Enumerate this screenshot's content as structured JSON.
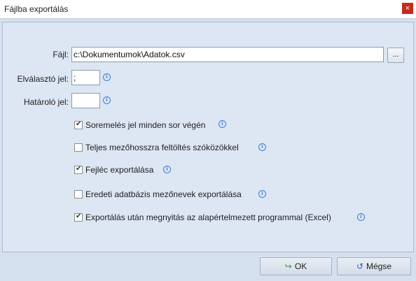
{
  "window": {
    "title": "Fájlba exportálás",
    "close_glyph": "×"
  },
  "form": {
    "file_label": "Fájl:",
    "file_value": "c:\\Dokumentumok\\Adatok.csv",
    "browse_label": "...",
    "separator_label": "Elválasztó jel:",
    "separator_value": ";",
    "delimiter_label": "Határoló jel:",
    "delimiter_value": ""
  },
  "options": [
    {
      "label": "Soremelés jel minden sor végén",
      "checked": true
    },
    {
      "label": "Teljes mezőhosszra feltöltés szóközökkel",
      "checked": false
    },
    {
      "label": "Fejléc exportálása",
      "checked": true
    },
    {
      "label": "Eredeti adatbázis mezőnevek exportálása",
      "checked": false
    },
    {
      "label": "Exportálás után megnyitás az alapértelmezett programmal (Excel)",
      "checked": true
    }
  ],
  "buttons": {
    "ok_label": "OK",
    "cancel_label": "Mégse"
  },
  "icons": {
    "info": "info-icon",
    "ok": "check-arrow-icon",
    "cancel": "undo-arrow-icon"
  }
}
